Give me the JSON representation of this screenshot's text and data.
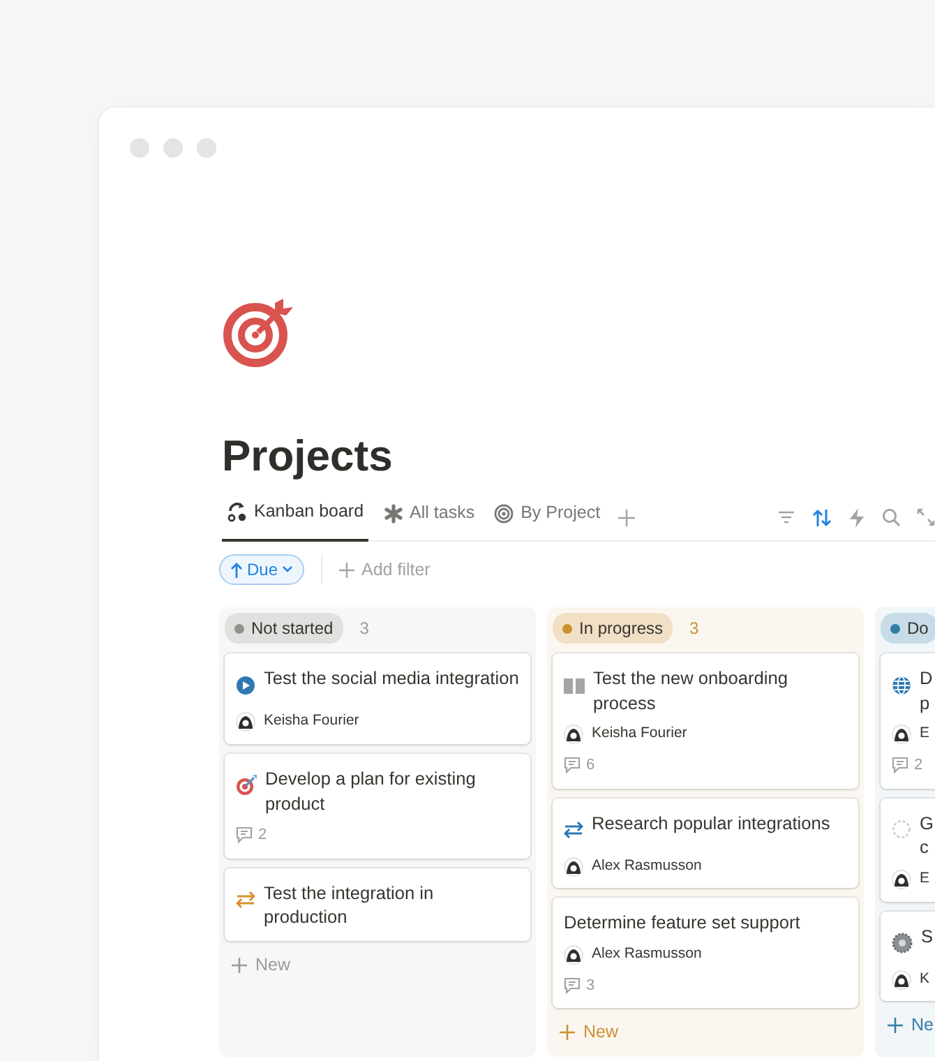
{
  "page": {
    "title": "Projects"
  },
  "tabs": [
    {
      "label": "Kanban board",
      "selected": true
    },
    {
      "label": "All tasks",
      "selected": false
    },
    {
      "label": "By Project",
      "selected": false
    }
  ],
  "toolbar": {
    "sort_active": true
  },
  "filters": {
    "sort_chip": "Due",
    "add_filter": "Add filter"
  },
  "columns": [
    {
      "label": "Not started",
      "count": "3",
      "color": "#91918e",
      "new_label": "New",
      "cards": [
        {
          "title": "Test the social media integration",
          "assignee": "Keisha Fourier"
        },
        {
          "title": "Develop a plan for existing product",
          "comments": "2"
        },
        {
          "title": "Test the integration in production"
        }
      ]
    },
    {
      "label": "In progress",
      "count": "3",
      "color": "#cb912f",
      "new_label": "New",
      "cards": [
        {
          "title": "Test the new onboarding process",
          "assignee": "Keisha Fourier",
          "comments": "6"
        },
        {
          "title": "Research popular integrations",
          "assignee": "Alex Rasmusson"
        },
        {
          "title": "Determine feature set support",
          "assignee": "Alex Rasmusson",
          "comments": "3"
        }
      ]
    },
    {
      "label": "Do",
      "color": "#337ea9",
      "new_label": "Ne",
      "cards": [
        {
          "title": "D\np",
          "assignee": "E",
          "comments": "2"
        },
        {
          "title": "G\nc",
          "assignee": "E"
        },
        {
          "title": "S",
          "assignee": "K"
        }
      ]
    }
  ]
}
